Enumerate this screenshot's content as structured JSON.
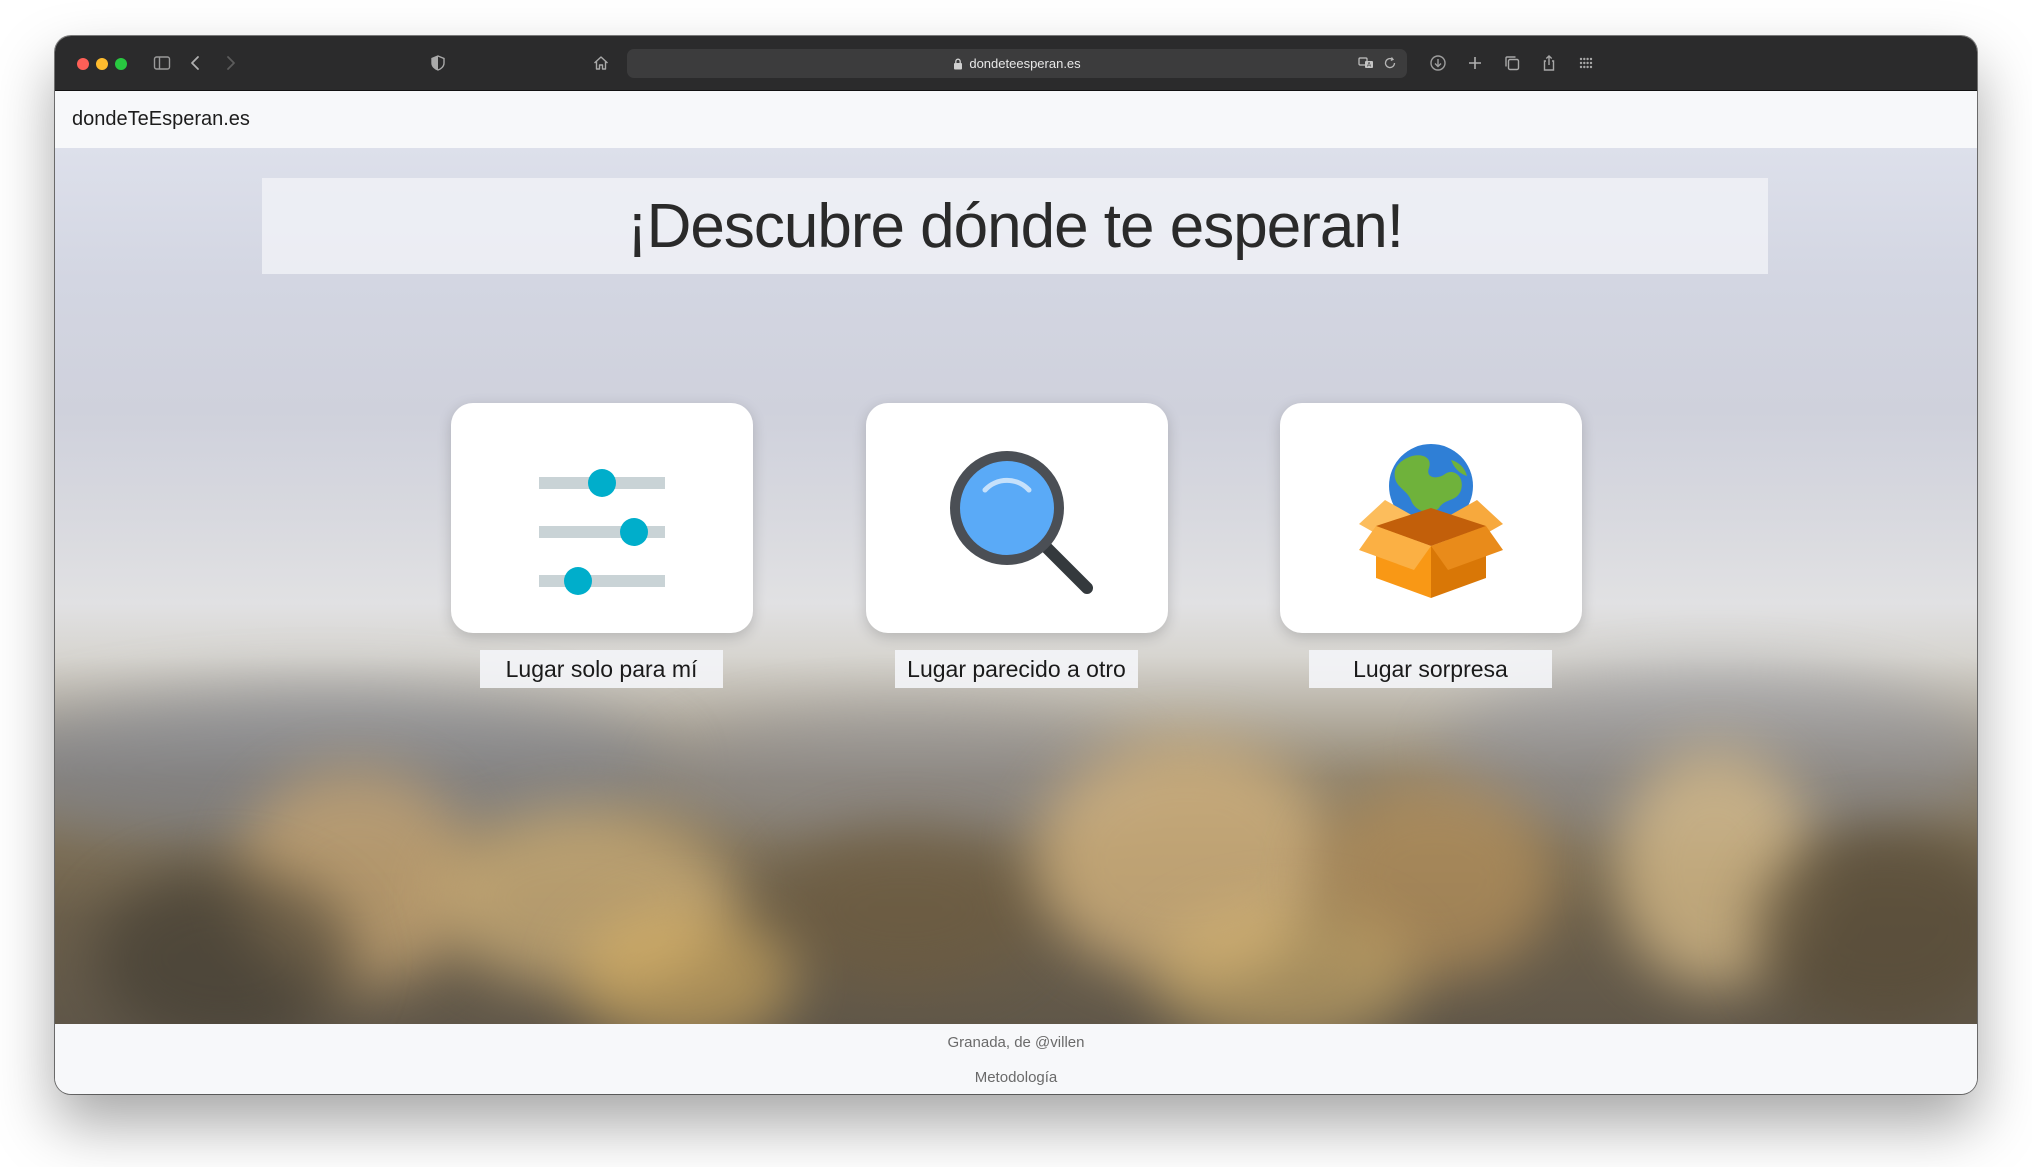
{
  "browser": {
    "url": "dondeteesperan.es",
    "icons": [
      "sidebar-icon",
      "back-icon",
      "forward-icon",
      "shield-icon",
      "home-icon",
      "lock-icon",
      "translate-icon",
      "reload-icon",
      "download-icon",
      "new-tab-icon",
      "tabs-icon",
      "share-icon",
      "grid-icon"
    ]
  },
  "navbar": {
    "brand": "dondeTeEsperan.es"
  },
  "hero": {
    "title": "¡Descubre dónde te esperan!",
    "options": [
      {
        "label": "Lugar solo para mí",
        "icon": "sliders-icon"
      },
      {
        "label": "Lugar parecido a otro",
        "icon": "magnifier-icon"
      },
      {
        "label": "Lugar sorpresa",
        "icon": "globe-box-icon"
      }
    ]
  },
  "footer": {
    "credit": "Granada, de @villen",
    "link": "Metodología"
  },
  "colors": {
    "accent": "#00aecb",
    "slider_track": "#c9d3d6",
    "magnifier_ring": "#4b4f55",
    "magnifier_glass": "#5aaaf7",
    "box_orange": "#f99815",
    "globe_blue": "#2f7fd6",
    "globe_green": "#6fb23b"
  }
}
